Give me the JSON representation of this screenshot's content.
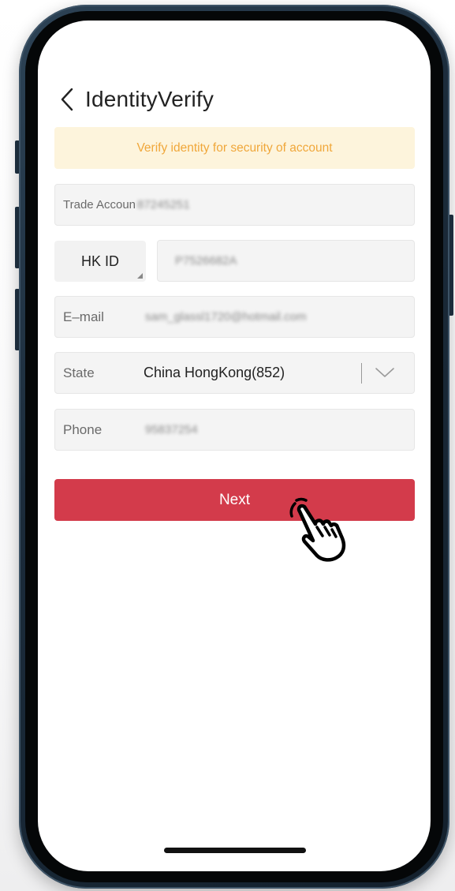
{
  "header": {
    "title": "IdentityVerify",
    "back_icon": "chevron-left-icon"
  },
  "notice": {
    "text": "Verify identity for security of account",
    "color": "#f0a73a",
    "background": "#fdf4dc"
  },
  "trade_account": {
    "label": "Trade Accoun",
    "value": "87245251"
  },
  "id": {
    "type": "HK ID",
    "value": "P7526682A"
  },
  "email": {
    "label": "E–mail",
    "value": "sam_glassl1720@hotmail.com"
  },
  "state": {
    "label": "State",
    "value": "China HongKong(852)",
    "dropdown_icon": "chevron-down-icon"
  },
  "phone": {
    "label": "Phone",
    "value": "95837254"
  },
  "next_button": {
    "label": "Next",
    "color": "#d33b4b"
  },
  "cursor": {
    "icon": "hand-pointer-icon"
  }
}
